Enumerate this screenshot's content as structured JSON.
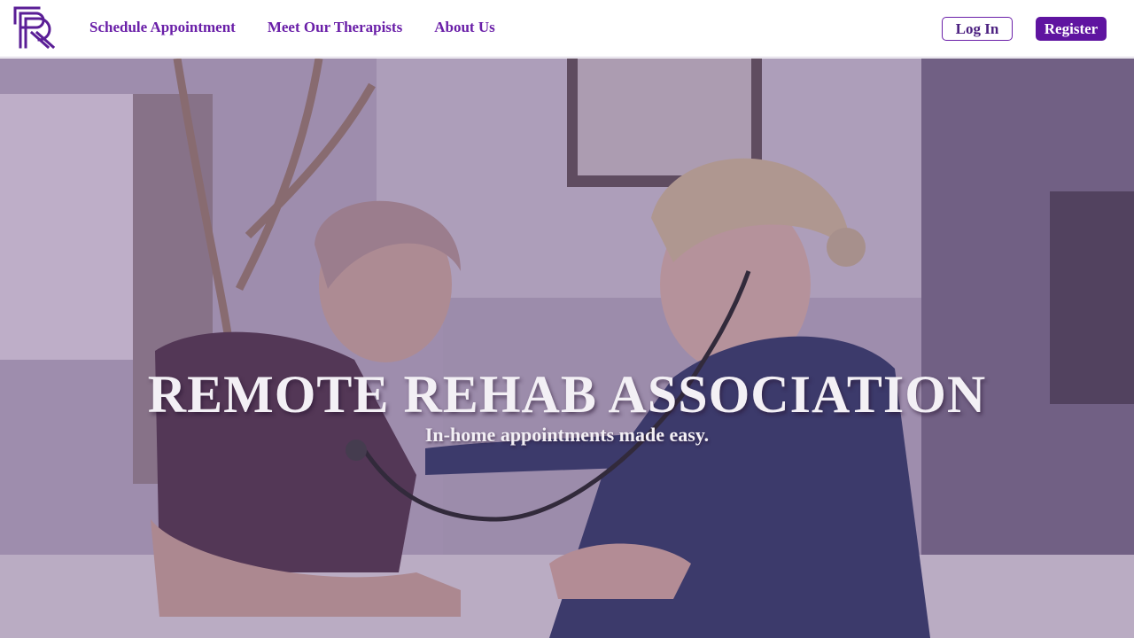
{
  "brand": {
    "logo_icon": "rr-monogram-logo-icon",
    "accent_color": "#5f14a0"
  },
  "nav": {
    "links": [
      "Schedule Appointment",
      "Meet Our Therapists",
      "About Us"
    ],
    "login_label": "Log In",
    "register_label": "Register"
  },
  "hero": {
    "title": "REMOTE REHAB ASSOCIATION",
    "subtitle": "In-home appointments made easy.",
    "image": "nurse-listening-with-stethoscope-to-smiling-patient-photo"
  }
}
